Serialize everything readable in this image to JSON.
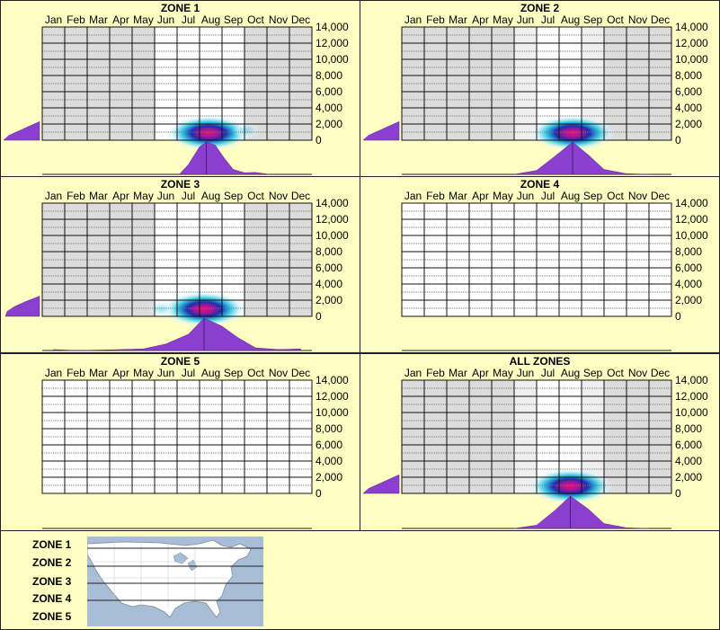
{
  "months": [
    "Jan",
    "Feb",
    "Mar",
    "Apr",
    "May",
    "Jun",
    "Jul",
    "Aug",
    "Sep",
    "Oct",
    "Nov",
    "Dec"
  ],
  "y_ticks": [
    "14,000",
    "12,000",
    "10,000",
    "8,000",
    "6,000",
    "4,000",
    "2,000",
    "0"
  ],
  "colors": {
    "background": "#ffffc4",
    "plot_bg": "#ffffff",
    "shaded_month": "#dcdcdc",
    "light_month": "#efefef",
    "density_fill": "#8a3fcf",
    "heat_outer": "#d8f4fa",
    "heat_mid": "#22c4e0",
    "heat_inner": "#1a2fb0",
    "heat_core": "#e0147a"
  },
  "legend": {
    "zones": [
      "ZONE 1",
      "ZONE 2",
      "ZONE 3",
      "ZONE 4",
      "ZONE 5"
    ],
    "map_icon": "north-america-map"
  },
  "chart_data": [
    {
      "type": "heatmap",
      "title": "ZONE 1",
      "x": "month",
      "y": "elevation",
      "ylim": [
        0,
        14000
      ],
      "shaded_months": [
        "Jan",
        "Feb",
        "Mar",
        "Apr",
        "May",
        "Oct",
        "Nov",
        "Dec"
      ],
      "light_months": [],
      "hotspots": [
        {
          "month": 7.9,
          "elev": 600,
          "intensity": 1.0
        },
        {
          "month": 9.6,
          "elev": 1200,
          "intensity": 0.15
        }
      ],
      "month_density": [
        {
          "month": 6.6,
          "v": 0.0
        },
        {
          "month": 7.0,
          "v": 0.3
        },
        {
          "month": 7.5,
          "v": 0.85
        },
        {
          "month": 7.8,
          "v": 1.0
        },
        {
          "month": 8.2,
          "v": 0.9
        },
        {
          "month": 8.6,
          "v": 0.5
        },
        {
          "month": 9.0,
          "v": 0.15
        },
        {
          "month": 9.5,
          "v": 0.05
        },
        {
          "month": 10.0,
          "v": 0.06
        },
        {
          "month": 10.6,
          "v": 0.0
        }
      ],
      "elev_density": [
        {
          "elev": 0,
          "v": 1.0
        },
        {
          "elev": 600,
          "v": 0.85
        },
        {
          "elev": 1200,
          "v": 0.55
        },
        {
          "elev": 1800,
          "v": 0.25
        },
        {
          "elev": 2300,
          "v": 0.0
        }
      ]
    },
    {
      "type": "heatmap",
      "title": "ZONE 2",
      "x": "month",
      "y": "elevation",
      "ylim": [
        0,
        14000
      ],
      "shaded_months": [
        "Jan",
        "Feb",
        "Mar",
        "Apr",
        "May",
        "Oct",
        "Nov",
        "Dec"
      ],
      "light_months": [
        "Jun",
        "Sep"
      ],
      "hotspots": [
        {
          "month": 8.1,
          "elev": 600,
          "intensity": 1.0
        }
      ],
      "month_density": [
        {
          "month": 5.5,
          "v": 0.0
        },
        {
          "month": 6.5,
          "v": 0.12
        },
        {
          "month": 7.3,
          "v": 0.55
        },
        {
          "month": 8.1,
          "v": 1.0
        },
        {
          "month": 8.8,
          "v": 0.6
        },
        {
          "month": 9.5,
          "v": 0.15
        },
        {
          "month": 10.5,
          "v": 0.02
        },
        {
          "month": 11.5,
          "v": 0.0
        }
      ],
      "elev_density": [
        {
          "elev": 0,
          "v": 1.0
        },
        {
          "elev": 600,
          "v": 0.85
        },
        {
          "elev": 1200,
          "v": 0.55
        },
        {
          "elev": 1800,
          "v": 0.25
        },
        {
          "elev": 2300,
          "v": 0.0
        }
      ]
    },
    {
      "type": "heatmap",
      "title": "ZONE 3",
      "x": "month",
      "y": "elevation",
      "ylim": [
        0,
        14000
      ],
      "shaded_months": [
        "Jan",
        "Feb",
        "Mar",
        "Apr",
        "May",
        "Oct",
        "Nov",
        "Dec"
      ],
      "light_months": [],
      "hotspots": [
        {
          "month": 7.7,
          "elev": 800,
          "intensity": 1.0
        },
        {
          "month": 5.8,
          "elev": 600,
          "intensity": 0.2
        }
      ],
      "month_density": [
        {
          "month": 1.0,
          "v": 0.03
        },
        {
          "month": 2.0,
          "v": 0.0
        },
        {
          "month": 3.5,
          "v": 0.02
        },
        {
          "month": 5.0,
          "v": 0.05
        },
        {
          "month": 6.0,
          "v": 0.2
        },
        {
          "month": 7.0,
          "v": 0.5
        },
        {
          "month": 7.7,
          "v": 1.0
        },
        {
          "month": 8.5,
          "v": 0.75
        },
        {
          "month": 9.2,
          "v": 0.4
        },
        {
          "month": 10.0,
          "v": 0.08
        },
        {
          "month": 11.0,
          "v": 0.03
        },
        {
          "month": 12.0,
          "v": 0.05
        }
      ],
      "elev_density": [
        {
          "elev": 0,
          "v": 0.95
        },
        {
          "elev": 600,
          "v": 0.9
        },
        {
          "elev": 1200,
          "v": 0.7
        },
        {
          "elev": 1800,
          "v": 0.4
        },
        {
          "elev": 2500,
          "v": 0.0
        }
      ]
    },
    {
      "type": "heatmap",
      "title": "ZONE 4",
      "x": "month",
      "y": "elevation",
      "ylim": [
        0,
        14000
      ],
      "shaded_months": [],
      "light_months": [],
      "hotspots": [],
      "month_density": [],
      "elev_density": []
    },
    {
      "type": "heatmap",
      "title": "ZONE 5",
      "x": "month",
      "y": "elevation",
      "ylim": [
        0,
        14000
      ],
      "shaded_months": [],
      "light_months": [],
      "hotspots": [],
      "month_density": [],
      "elev_density": []
    },
    {
      "type": "heatmap",
      "title": "ALL ZONES",
      "x": "month",
      "y": "elevation",
      "ylim": [
        0,
        14000
      ],
      "shaded_months": [
        "Jan",
        "Feb",
        "Mar",
        "Apr",
        "May",
        "Oct",
        "Nov",
        "Dec"
      ],
      "light_months": [
        "Jun",
        "Sep"
      ],
      "hotspots": [
        {
          "month": 8.0,
          "elev": 600,
          "intensity": 1.0
        }
      ],
      "month_density": [
        {
          "month": 5.5,
          "v": 0.0
        },
        {
          "month": 6.5,
          "v": 0.1
        },
        {
          "month": 7.3,
          "v": 0.55
        },
        {
          "month": 8.0,
          "v": 1.0
        },
        {
          "month": 8.8,
          "v": 0.6
        },
        {
          "month": 9.5,
          "v": 0.15
        },
        {
          "month": 10.5,
          "v": 0.02
        },
        {
          "month": 11.5,
          "v": 0.0
        }
      ],
      "elev_density": [
        {
          "elev": 0,
          "v": 1.0
        },
        {
          "elev": 600,
          "v": 0.85
        },
        {
          "elev": 1200,
          "v": 0.55
        },
        {
          "elev": 1800,
          "v": 0.25
        },
        {
          "elev": 2300,
          "v": 0.0
        }
      ]
    }
  ]
}
